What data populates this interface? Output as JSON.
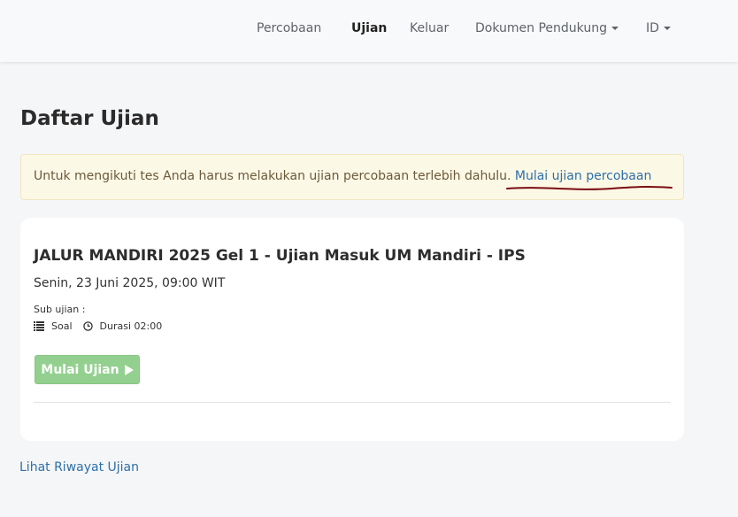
{
  "nav": {
    "items": [
      "Percobaan",
      "Ujian",
      "Keluar"
    ],
    "dokumen_label": "Dokumen Pendukung",
    "language_label": "ID"
  },
  "page_title": "Daftar Ujian",
  "alert": {
    "message": "Untuk mengikuti tes Anda harus melakukan ujian percobaan terlebih dahulu.",
    "link_text": "Mulai ujian percobaan"
  },
  "exam": {
    "title": "JALUR MANDIRI 2025 Gel 1 - Ujian Masuk UM Mandiri - IPS",
    "date": "Senin, 23 Juni 2025, 09:00 WIT",
    "sub_label": "Sub ujian :",
    "sub_items": {
      "soal": "Soal",
      "durasi": "Durasi 02:00"
    },
    "start_button": "Mulai Ujian"
  },
  "history_link": "Lihat Riwayat Ujian",
  "colors": {
    "accent_link": "#2d6fa8",
    "start_button": "#93d08f",
    "alert_bg": "#fcf8e6",
    "annotation": "#7a0d14"
  },
  "icons": {
    "soal": "list-icon",
    "durasi": "clock-icon",
    "start": "play-icon"
  }
}
